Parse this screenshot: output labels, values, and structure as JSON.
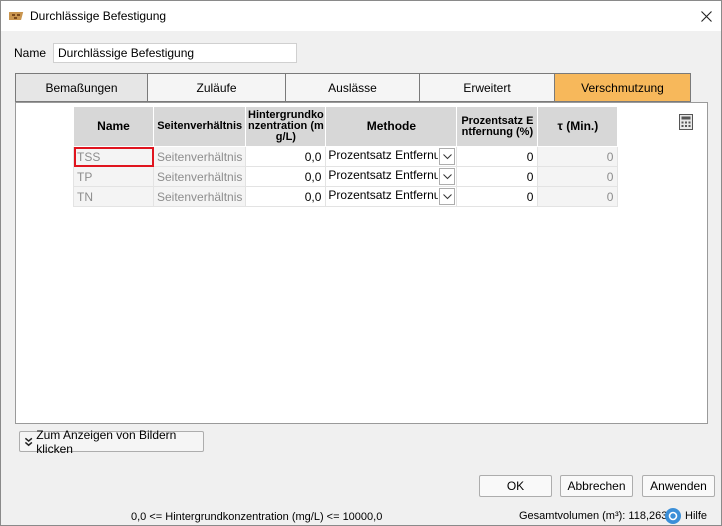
{
  "window": {
    "title": "Durchlässige Befestigung"
  },
  "name_field": {
    "label": "Name",
    "value": "Durchlässige Befestigung"
  },
  "tabs": [
    {
      "label": "Bemaßungen"
    },
    {
      "label": "Zuläufe"
    },
    {
      "label": "Auslässe"
    },
    {
      "label": "Erweitert"
    },
    {
      "label": "Verschmutzung",
      "active": true
    }
  ],
  "grid": {
    "headers": [
      "Name",
      "Seitenverhältnis",
      "Hintergrundkonzentration (mg/L)",
      "Methode",
      "Prozentsatz Entfernung (%)",
      "τ (Min.)"
    ],
    "rows": [
      {
        "name": "TSS",
        "ratio": "Seitenverhältnis",
        "conc": "0,0",
        "method": "Prozentsatz Entfernung",
        "percent": "0",
        "tau": "0"
      },
      {
        "name": "TP",
        "ratio": "Seitenverhältnis",
        "conc": "0,0",
        "method": "Prozentsatz Entfernung",
        "percent": "0",
        "tau": "0"
      },
      {
        "name": "TN",
        "ratio": "Seitenverhältnis",
        "conc": "0,0",
        "method": "Prozentsatz Entfernung",
        "percent": "0",
        "tau": "0"
      }
    ]
  },
  "icons": {
    "calculator": "calculator-icon",
    "expand": "double-chevron-down-icon",
    "help": "help-icon",
    "app": "pavement-icon"
  },
  "colors": {
    "active_tab": "#f7b85b",
    "selection": "#e0141e"
  },
  "images_button": {
    "label": "Zum Anzeigen von Bildern klicken"
  },
  "buttons": {
    "ok": "OK",
    "cancel": "Abbrechen",
    "apply": "Anwenden"
  },
  "status": {
    "range": "0,0 <= Hintergrundkonzentration (mg/L) <= 10000,0",
    "volume": "Gesamtvolumen (m³): 118,263",
    "help": "Hilfe"
  }
}
